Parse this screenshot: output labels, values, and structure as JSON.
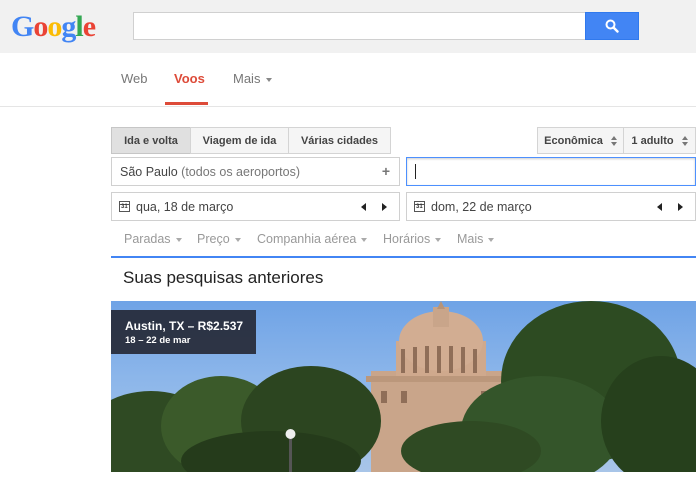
{
  "header": {
    "logo_letters": [
      {
        "ch": "G",
        "color": "#4285f4"
      },
      {
        "ch": "o",
        "color": "#ea4335"
      },
      {
        "ch": "o",
        "color": "#fbbc05"
      },
      {
        "ch": "g",
        "color": "#4285f4"
      },
      {
        "ch": "l",
        "color": "#34a853"
      },
      {
        "ch": "e",
        "color": "#ea4335"
      }
    ],
    "search_value": "",
    "search_button_icon": "search-icon"
  },
  "nav": {
    "web": "Web",
    "flights": "Voos",
    "more": "Mais"
  },
  "trip_type": {
    "round_trip": "Ida e volta",
    "one_way": "Viagem de ida",
    "multi_city": "Várias cidades"
  },
  "cabin": "Econômica",
  "passengers": "1 adulto",
  "origin": {
    "city": "São Paulo",
    "hint": "(todos os aeroportos)"
  },
  "destination": {
    "value": ""
  },
  "dates": {
    "departure": "qua, 18 de março",
    "return": "dom, 22 de março"
  },
  "filters": [
    "Paradas",
    "Preço",
    "Companhia aérea",
    "Horários",
    "Mais"
  ],
  "previous_searches": {
    "title": "Suas pesquisas anteriores",
    "card": {
      "destination_price": "Austin, TX – R$2.537",
      "date_range": "18 – 22 de mar"
    }
  },
  "colors": {
    "accent_red": "#dd4b39",
    "accent_blue": "#4285f4"
  }
}
